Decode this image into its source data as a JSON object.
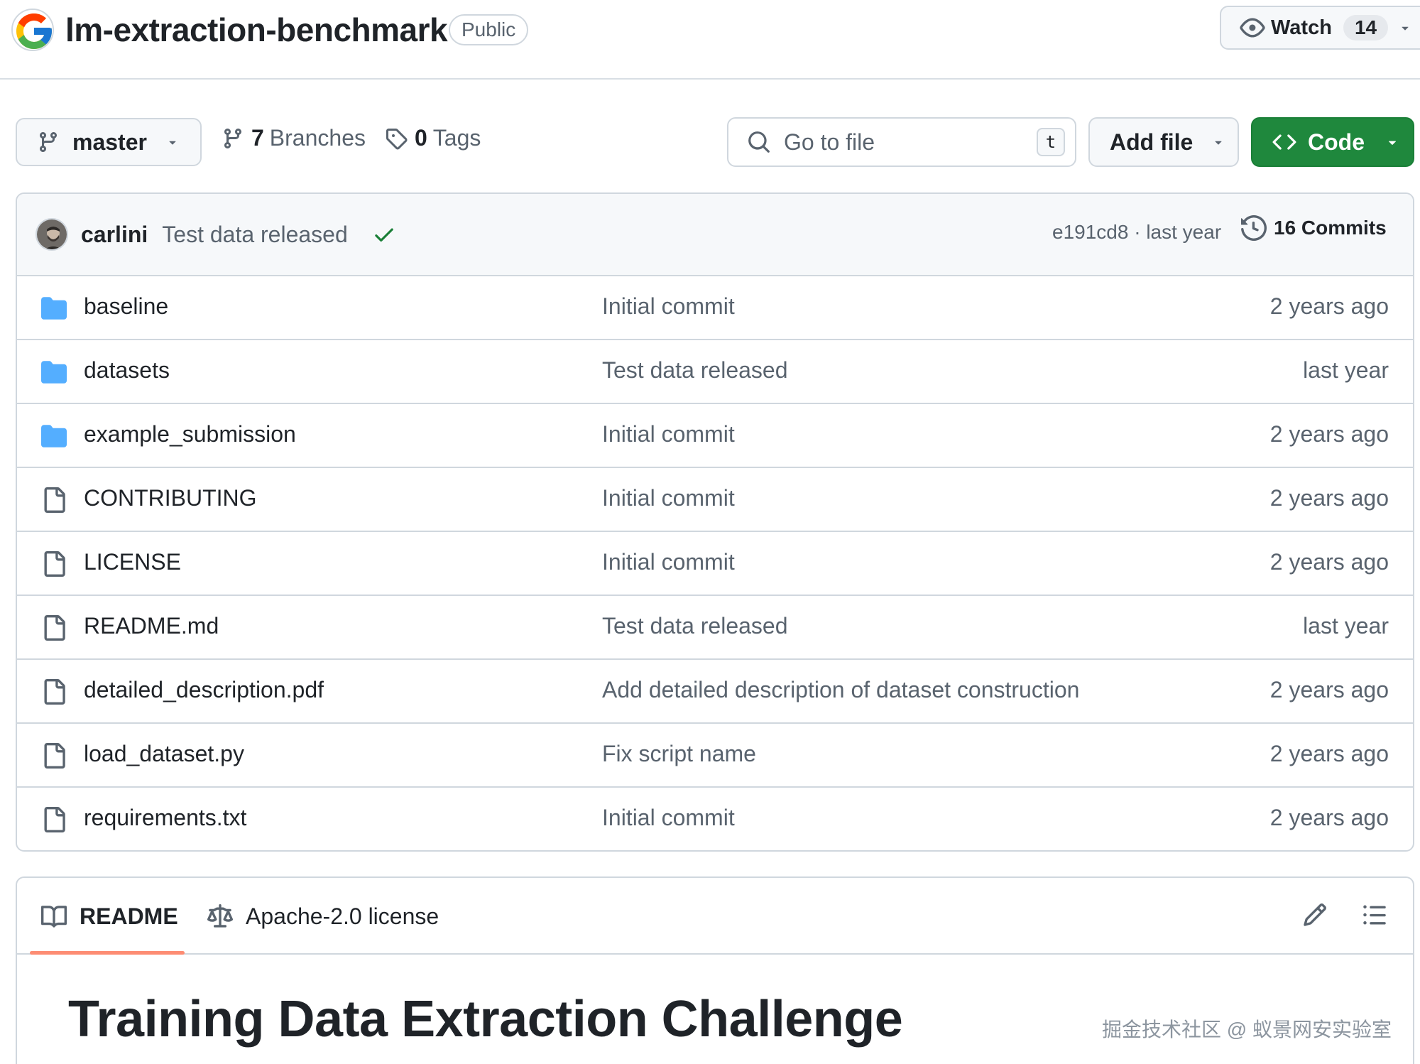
{
  "repo": {
    "name": "lm-extraction-benchmark",
    "visibility": "Public",
    "logo_icon": "google-g-logo-icon"
  },
  "watch": {
    "label": "Watch",
    "count": "14"
  },
  "toolbar": {
    "branch": "master",
    "branches_count": "7",
    "branches_label": "Branches",
    "tags_count": "0",
    "tags_label": "Tags",
    "search_placeholder": "Go to file",
    "search_shortcut": "t",
    "add_file_label": "Add file",
    "code_label": "Code",
    "code_color": "#1f883d"
  },
  "latest_commit": {
    "author": "carlini",
    "message": "Test data released",
    "meta": "e191cd8 · last year",
    "commits_label": "16 Commits",
    "status_color": "#1a7f37"
  },
  "files": [
    {
      "name": "baseline",
      "type": "folder",
      "message": "Initial commit",
      "age": "2 years ago"
    },
    {
      "name": "datasets",
      "type": "folder",
      "message": "Test data released",
      "age": "last year"
    },
    {
      "name": "example_submission",
      "type": "folder",
      "message": "Initial commit",
      "age": "2 years ago"
    },
    {
      "name": "CONTRIBUTING",
      "type": "file",
      "message": "Initial commit",
      "age": "2 years ago"
    },
    {
      "name": "LICENSE",
      "type": "file",
      "message": "Initial commit",
      "age": "2 years ago"
    },
    {
      "name": "README.md",
      "type": "file",
      "message": "Test data released",
      "age": "last year"
    },
    {
      "name": "detailed_description.pdf",
      "type": "file",
      "message": "Add detailed description of dataset construction",
      "age": "2 years ago"
    },
    {
      "name": "load_dataset.py",
      "type": "file",
      "message": "Fix script name",
      "age": "2 years ago"
    },
    {
      "name": "requirements.txt",
      "type": "file",
      "message": "Initial commit",
      "age": "2 years ago"
    }
  ],
  "readme": {
    "tab_readme": "README",
    "tab_license": "Apache-2.0 license",
    "title": "Training Data Extraction Challenge",
    "active_tab_color": "#fd8c73"
  },
  "watermark": "掘金技术社区 @ 蚁景网安实验室",
  "colors": {
    "folder": "#54aeff",
    "border": "#d0d7de",
    "muted": "#59636e"
  }
}
